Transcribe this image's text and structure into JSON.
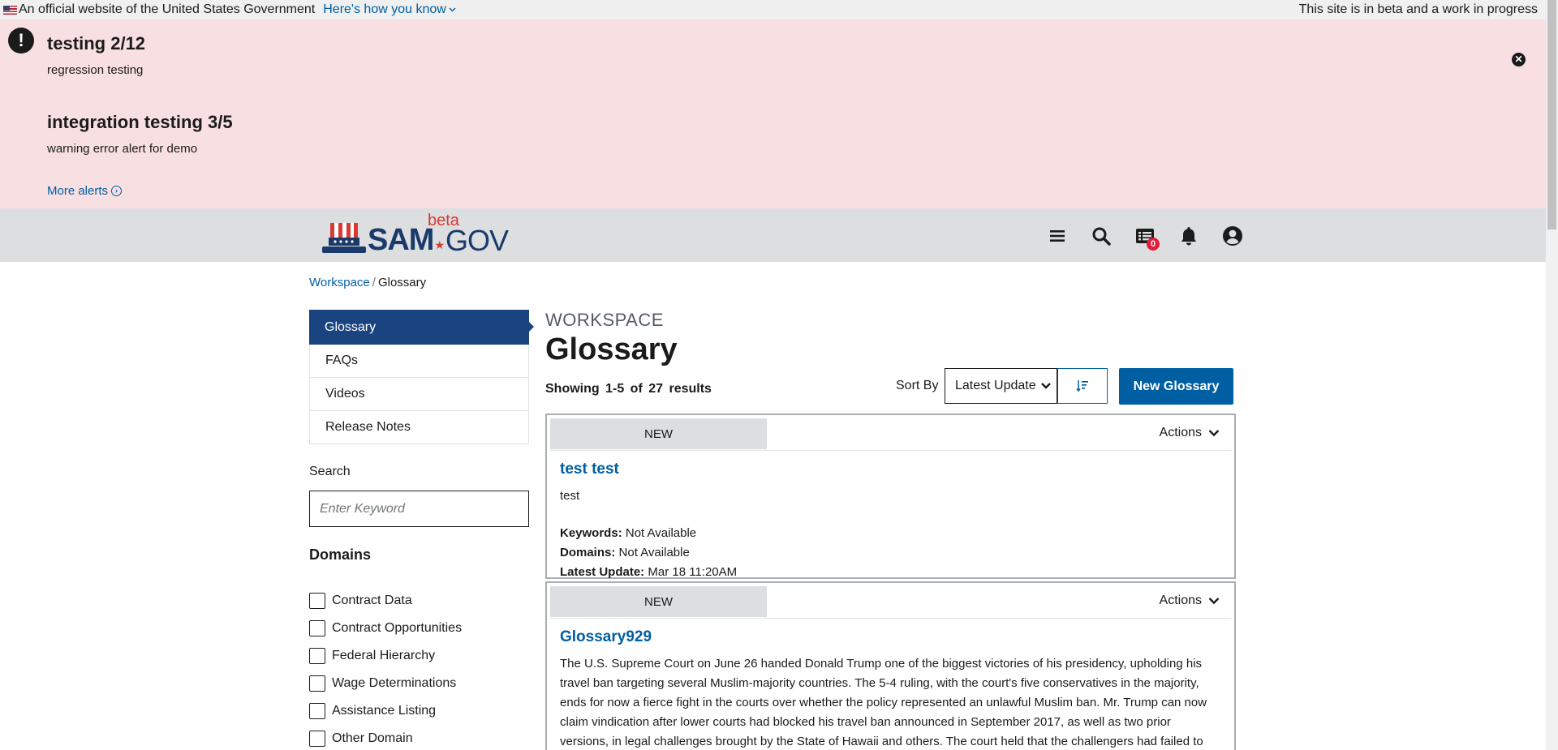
{
  "gov_banner": {
    "official_text": "An official website of the United States Government",
    "how_link": "Here's how you know",
    "beta_notice": "This site is in beta and a work in progress"
  },
  "alerts": {
    "items": [
      {
        "title": "testing 2/12",
        "text": "regression testing"
      },
      {
        "title": "integration testing 3/5",
        "text": "warning error alert for demo"
      }
    ],
    "more_label": "More alerts"
  },
  "header": {
    "logo_sam": "SAM",
    "logo_gov": "GOV",
    "logo_beta": "beta",
    "notification_count": "0",
    "icons": [
      "menu-icon",
      "search-icon",
      "workspace-icon",
      "bell-icon",
      "user-icon"
    ]
  },
  "breadcrumb": {
    "parent": "Workspace",
    "separator": "/",
    "current": "Glossary"
  },
  "sidebar": {
    "items": [
      {
        "label": "Glossary"
      },
      {
        "label": "FAQs"
      },
      {
        "label": "Videos"
      },
      {
        "label": "Release Notes"
      }
    ],
    "search_label": "Search",
    "search_placeholder": "Enter Keyword",
    "domains_title": "Domains",
    "domains": [
      {
        "label": "Contract Data"
      },
      {
        "label": "Contract Opportunities"
      },
      {
        "label": "Federal Hierarchy"
      },
      {
        "label": "Wage Determinations"
      },
      {
        "label": "Assistance Listing"
      },
      {
        "label": "Other Domain"
      }
    ]
  },
  "main": {
    "section_label": "WORKSPACE",
    "title": "Glossary",
    "showing_text": "Showing 1-5 of 27 results",
    "sort_label": "Sort By",
    "sort_value": "Latest Update",
    "new_button": "New Glossary",
    "results": [
      {
        "tag": "NEW",
        "actions": "Actions",
        "title": "test test",
        "description": "test",
        "keywords_label": "Keywords:",
        "keywords": "Not Available",
        "domains_label": "Domains:",
        "domains": "Not Available",
        "update_label": "Latest Update:",
        "update": "Mar 18 11:20AM"
      },
      {
        "tag": "NEW",
        "actions": "Actions",
        "title": "Glossary929",
        "description": "The U.S. Supreme Court on June 26 handed Donald Trump one of the biggest victories of his presidency, upholding his travel ban targeting several Muslim-majority countries. The 5-4 ruling, with the court's five conservatives in the majority, ends for now a fierce fight in the courts over whether the policy represented an unlawful Muslim ban. Mr. Trump can now claim vindication after lower courts had blocked his travel ban announced in September 2017, as well as two prior versions, in legal challenges brought by the State of Hawaii and others. The court held that the challengers had failed to show that the ban"
      }
    ]
  },
  "colors": {
    "alert_bg": "#f8dfe1",
    "header_bg": "#dcdee0",
    "primary": "#005ea2",
    "nav_active": "#1a4480",
    "logo_navy": "#1a3a6b",
    "logo_red": "#d83933"
  }
}
